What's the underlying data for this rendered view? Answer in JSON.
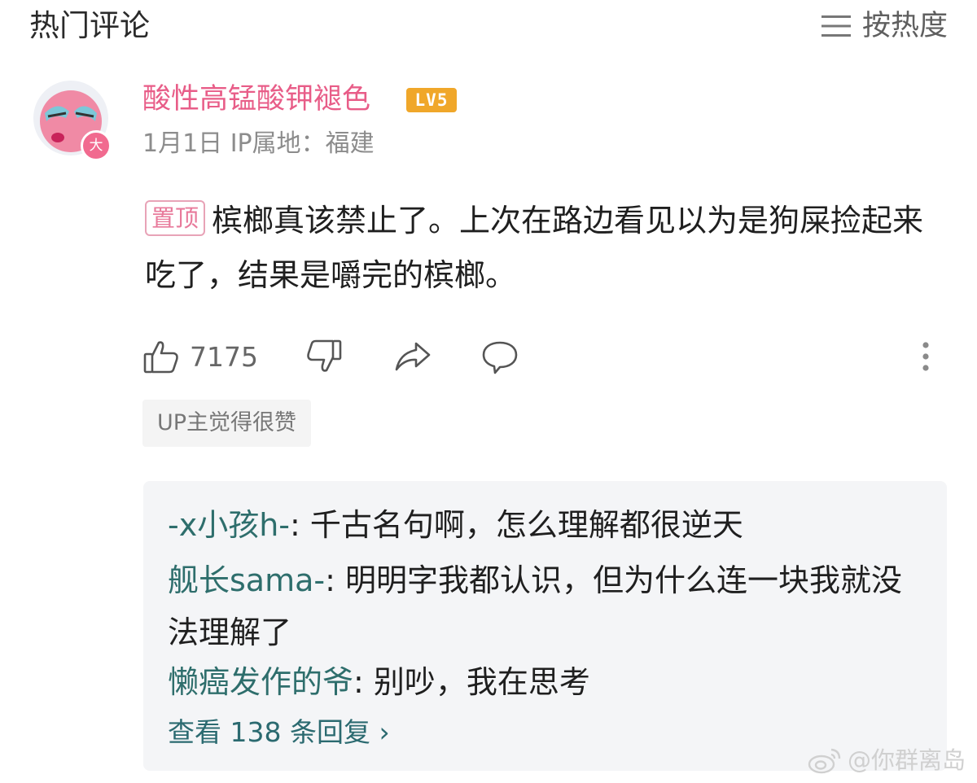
{
  "header": {
    "title": "热门评论",
    "sort_label": "按热度",
    "sort_icon": "menu-icon"
  },
  "comment": {
    "username": "酸性高锰酸钾褪色",
    "level": "LV5",
    "avatar_badge": "大",
    "meta": "1月1日 IP属地：福建",
    "pinned_label": "置顶",
    "text": "槟榔真该禁止了。上次在路边看见以为是狗屎捡起来吃了，结果是嚼完的槟榔。",
    "likes": "7175",
    "up_liked": "UP主觉得很赞",
    "colors": {
      "username": "#e85d88",
      "level_badge": "#f0a72a",
      "reply_name": "#2e6e6c"
    }
  },
  "replies": [
    {
      "name": "-x小孩h-",
      "text": ": 千古名句啊，怎么理解都很逆天"
    },
    {
      "name": "舰长sama-",
      "text": ": 明明字我都认识，但为什么连一块我就没法理解了"
    },
    {
      "name": "懒癌发作的爷",
      "text": ": 别吵，我在思考"
    }
  ],
  "view_more": "查看 138 条回复 ›",
  "watermark": "@你群离岛"
}
